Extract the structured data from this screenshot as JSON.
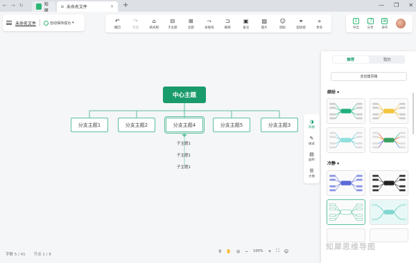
{
  "titlebar": {
    "nav": [
      "←",
      "→",
      "↻"
    ],
    "tabs": [
      {
        "label": "知犀",
        "close": ""
      },
      {
        "label": "未命名文件",
        "close": "×"
      }
    ],
    "new_tab": "+",
    "window_controls": [
      "—",
      "❐",
      "✕"
    ]
  },
  "file": {
    "name": "未命名文件",
    "sync_status": "自动保存成功",
    "sync_caret": "▾"
  },
  "toolbar": [
    {
      "icon": "undo-icon",
      "glyph": "↶",
      "label": "撤回",
      "disabled": false
    },
    {
      "icon": "redo-icon",
      "glyph": "↷",
      "label": "恢复",
      "disabled": true
    },
    {
      "icon": "format-painter-icon",
      "glyph": "⌂",
      "label": "格式刷",
      "disabled": false
    },
    {
      "icon": "subtopic-icon",
      "glyph": "⊟",
      "label": "子主题",
      "disabled": false
    },
    {
      "icon": "topic-icon",
      "glyph": "⊞",
      "label": "主题",
      "disabled": false
    },
    {
      "icon": "relation-line-icon",
      "glyph": "⤳",
      "label": "关联线",
      "disabled": false
    },
    {
      "icon": "summary-icon",
      "glyph": "⊐",
      "label": "概要",
      "disabled": false
    },
    {
      "icon": "note-icon",
      "glyph": "▣",
      "label": "备注",
      "disabled": false
    },
    {
      "icon": "image-icon",
      "glyph": "▨",
      "label": "图片",
      "disabled": false
    },
    {
      "icon": "emoji-icon",
      "glyph": "☺",
      "label": "图标",
      "disabled": false
    },
    {
      "icon": "link-icon",
      "glyph": "⚭",
      "label": "超链接",
      "disabled": false
    },
    {
      "icon": "more-icon",
      "glyph": "»",
      "label": "更多",
      "disabled": false
    }
  ],
  "right_tools": [
    {
      "icon": "export-icon",
      "glyph": "↥",
      "label": "导出"
    },
    {
      "icon": "share-icon",
      "glyph": "⤴",
      "label": "分享"
    },
    {
      "icon": "collab-icon",
      "glyph": "⌘",
      "label": "协作"
    }
  ],
  "mindmap": {
    "root": "中心主题",
    "branches": [
      "分支主题1",
      "分支主题2",
      "分支主题4",
      "分支主题5",
      "分支主题3"
    ],
    "subtopics": [
      "子主题1",
      "子主题1",
      "子主题1"
    ]
  },
  "side_tabs": [
    {
      "icon": "palette-icon",
      "glyph": "◑",
      "label": "风格",
      "active": true
    },
    {
      "icon": "brush-icon",
      "glyph": "✎",
      "label": "样式",
      "active": false
    },
    {
      "icon": "canvas-icon",
      "glyph": "▤",
      "label": "画布",
      "active": false
    },
    {
      "icon": "outline-icon",
      "glyph": "☰",
      "label": "大纲",
      "active": false
    }
  ],
  "panel": {
    "tabs": [
      "推荐",
      "我的"
    ],
    "active_tab": "推荐",
    "custom_button": "去创建风格",
    "sections": [
      "缤纷 ▾",
      "冷静 ▾"
    ]
  },
  "status": {
    "words": "字数 5 / 41",
    "nodes": "节点 1 / 9"
  },
  "zoom": {
    "level": "100%",
    "minus": "−",
    "plus": "+"
  },
  "watermark": "知犀思维导图",
  "colors": {
    "accent": "#1a9b6c",
    "branch_border": "#5cbf9c",
    "panel_bg": "#ffffff",
    "canvas_bg": "#f5f6f8"
  }
}
